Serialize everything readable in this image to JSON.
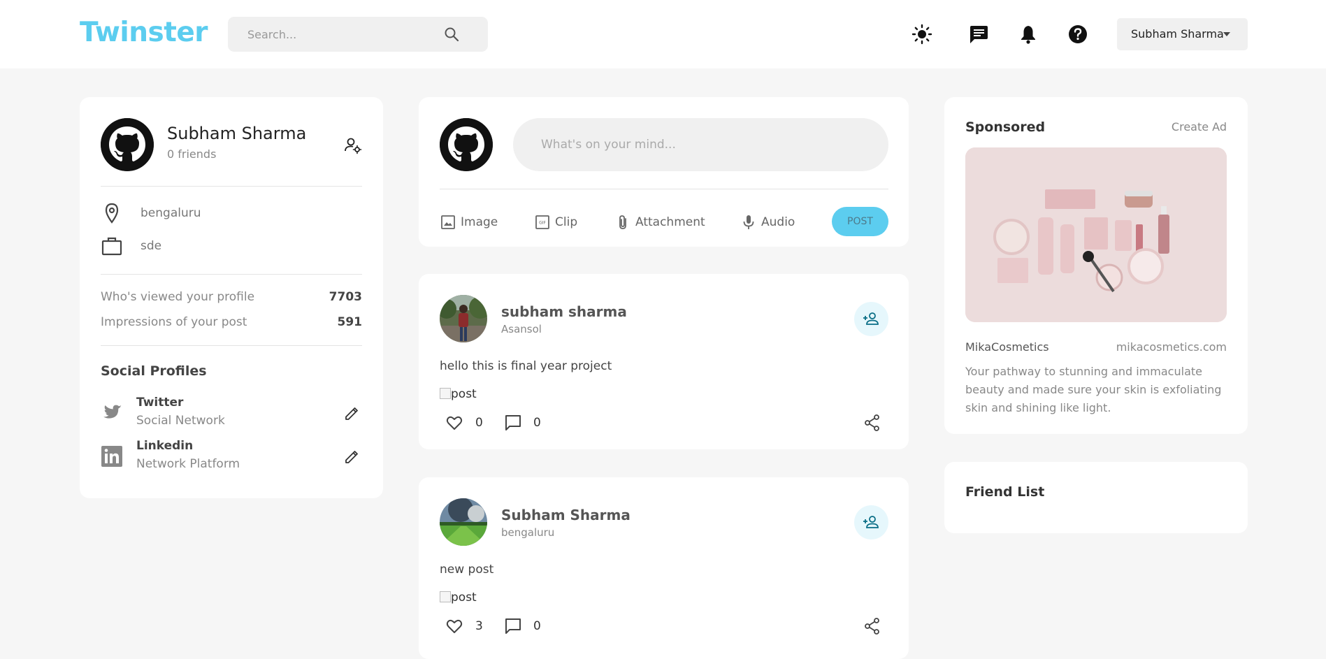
{
  "header": {
    "logo": "Twinster",
    "search_placeholder": "Search...",
    "icons": [
      "search-icon",
      "light-mode-icon",
      "messages-icon",
      "notifications-icon",
      "help-icon"
    ],
    "user_select": {
      "selected": "Subham Sharma"
    }
  },
  "profile": {
    "name": "Subham Sharma",
    "friends": "0 friends",
    "location": "bengaluru",
    "occupation": "sde",
    "stats": [
      {
        "label": "Who's viewed your profile",
        "value": "7703"
      },
      {
        "label": "Impressions of your post",
        "value": "591"
      }
    ],
    "social_title": "Social Profiles",
    "social": [
      {
        "name": "Twitter",
        "sub": "Social Network"
      },
      {
        "name": "Linkedin",
        "sub": "Network Platform"
      }
    ]
  },
  "composer": {
    "placeholder": "What's on your mind...",
    "options": {
      "image": "Image",
      "clip": "Clip",
      "attachment": "Attachment",
      "audio": "Audio"
    },
    "post_label": "POST"
  },
  "posts": [
    {
      "name": "subham sharma",
      "location": "Asansol",
      "text": "hello this is final year project",
      "img_alt": "post",
      "likes": "0",
      "comments": "0"
    },
    {
      "name": "Subham Sharma",
      "location": "bengaluru",
      "text": "new post",
      "img_alt": "post",
      "likes": "3",
      "comments": "0"
    }
  ],
  "sponsored": {
    "title": "Sponsored",
    "create_ad": "Create Ad",
    "brand": "MikaCosmetics",
    "url": "mikacosmetics.com",
    "description": "Your pathway to stunning and immaculate beauty and made sure your skin is exfoliating skin and shining like light."
  },
  "friend_list": {
    "title": "Friend List"
  },
  "colors": {
    "brand": "#5ccdef",
    "background": "#f6f6f6",
    "card": "#ffffff"
  }
}
